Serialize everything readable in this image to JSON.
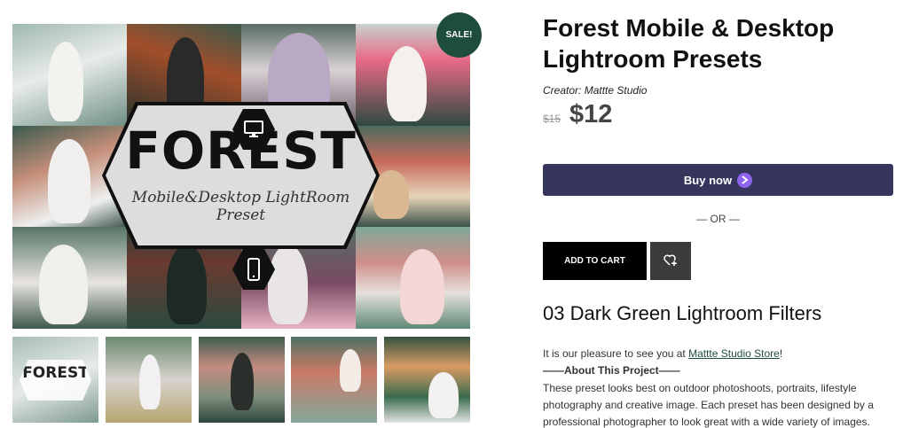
{
  "sale_badge": "SALE!",
  "gallery": {
    "brand_title": "FOREST",
    "brand_subtitle": "Mobile&Desktop LightRoom Preset",
    "thumb_labels": [
      "FOREST"
    ]
  },
  "product": {
    "title": "Forest Mobile & Desktop Lightroom Presets",
    "creator_label": "Creator:",
    "creator_name": "Mattte Studio",
    "old_price": "$15",
    "new_price": "$12",
    "buy_now_label": "Buy now",
    "or_label": "— OR —",
    "add_to_cart_label": "ADD TO CART",
    "subtitle": "03 Dark Green Lightroom Filters"
  },
  "description": {
    "intro_prefix": "It is our pleasure to see you at ",
    "store_link": "Mattte Studio Store",
    "intro_suffix": "!",
    "heading": "——About This Project——",
    "body": "These preset looks best on outdoor photoshoots, portraits, lifestyle photography and creative image. Each preset has been designed by a professional photographer to look great with a wide variety of images."
  },
  "colors": {
    "buy_button": "#36355e",
    "sale_badge": "#1e4d3c",
    "buy_icon": "#8e63ee"
  }
}
